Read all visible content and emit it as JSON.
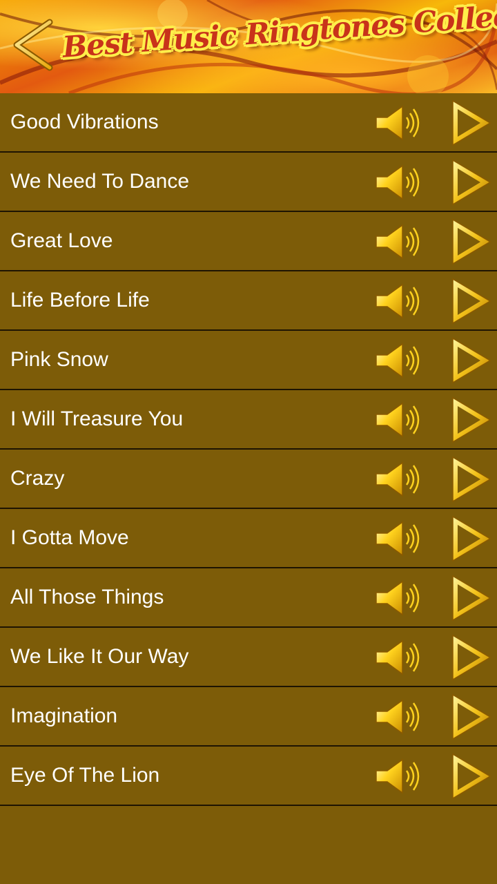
{
  "header": {
    "title": "Best Music Ringtones Collection",
    "back_icon": "back-arrow-icon"
  },
  "ringtones": [
    {
      "title": "Good Vibrations"
    },
    {
      "title": "We Need To Dance"
    },
    {
      "title": "Great Love"
    },
    {
      "title": "Life Before Life"
    },
    {
      "title": "Pink Snow"
    },
    {
      "title": "I Will Treasure You"
    },
    {
      "title": "Crazy"
    },
    {
      "title": "I Gotta Move"
    },
    {
      "title": "All Those Things"
    },
    {
      "title": "We Like It Our Way"
    },
    {
      "title": "Imagination"
    },
    {
      "title": "Eye Of The Lion"
    }
  ],
  "icons": {
    "set_ringtone": "speaker-icon",
    "play": "play-icon"
  },
  "colors": {
    "background": "#7d5c08",
    "row_divider": "#1e1402",
    "text": "#ffffff",
    "icon_gold": "#ffd21e",
    "title_red": "#c8331a",
    "title_outline": "#ffee4a"
  }
}
